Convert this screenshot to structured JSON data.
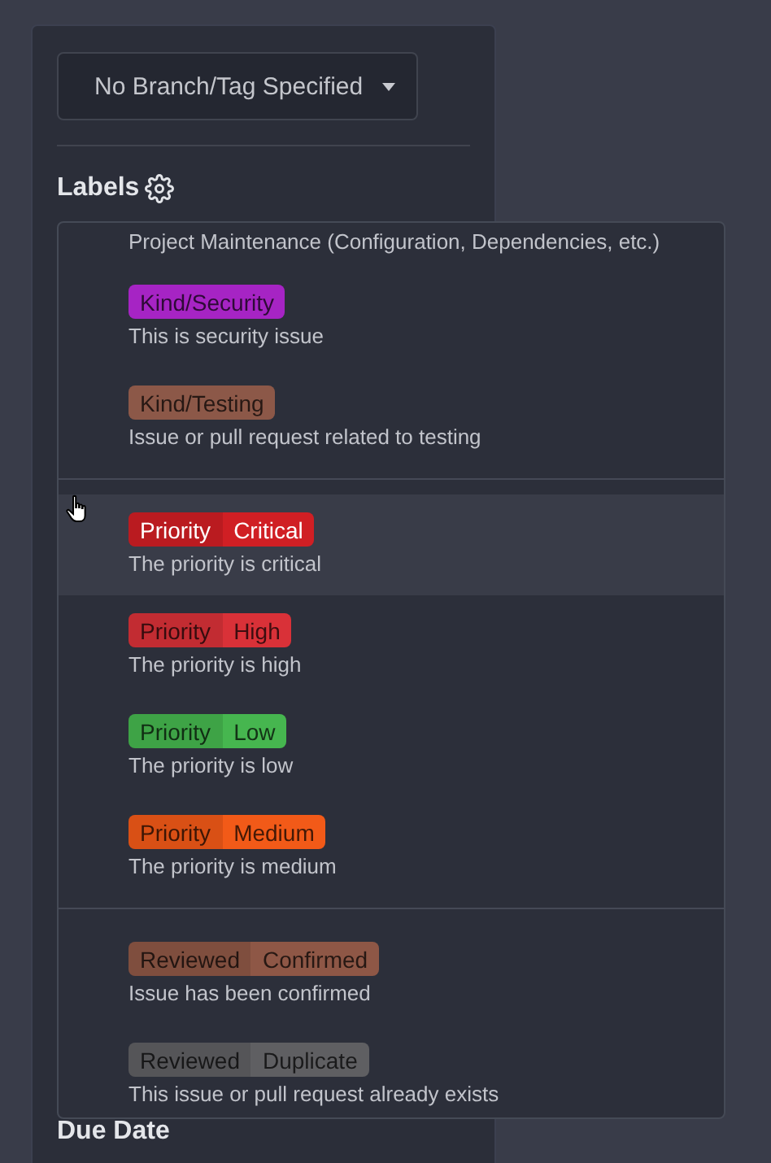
{
  "branch_dropdown": {
    "label": "No Branch/Tag Specified"
  },
  "labels_heading": "Labels",
  "label_menu": {
    "groups": [
      {
        "items": [
          {
            "kind": "description_only",
            "description": "Project Maintenance (Configuration, Dependencies, etc.)",
            "selected": false
          },
          {
            "kind": "plain",
            "name": "Kind/Security",
            "color": "#a624c4",
            "light_text": false,
            "description": "This is security issue",
            "selected": false
          },
          {
            "kind": "plain",
            "name": "Kind/Testing",
            "color": "#8c5848",
            "light_text": false,
            "description": "Issue or pull request related to testing",
            "selected": false
          }
        ]
      },
      {
        "items": [
          {
            "kind": "scoped",
            "scope": "Priority",
            "value": "Critical",
            "color": "#d01f24",
            "light_text": true,
            "description": "The priority is critical",
            "selected": true
          },
          {
            "kind": "scoped",
            "scope": "Priority",
            "value": "High",
            "color": "#d93138",
            "light_text": false,
            "description": "The priority is high",
            "selected": false
          },
          {
            "kind": "scoped",
            "scope": "Priority",
            "value": "Low",
            "color": "#46b64f",
            "light_text": false,
            "description": "The priority is low",
            "selected": false
          },
          {
            "kind": "scoped",
            "scope": "Priority",
            "value": "Medium",
            "color": "#f25a18",
            "light_text": false,
            "description": "The priority is medium",
            "selected": false
          }
        ]
      },
      {
        "items": [
          {
            "kind": "scoped",
            "scope": "Reviewed",
            "value": "Confirmed",
            "color": "#8e5746",
            "light_text": false,
            "description": "Issue has been confirmed",
            "selected": false
          },
          {
            "kind": "scoped",
            "scope": "Reviewed",
            "value": "Duplicate",
            "color": "#5f5f62",
            "light_text": false,
            "description": "This issue or pull request already exists",
            "selected": false
          }
        ]
      }
    ]
  },
  "due_date_heading": "Due Date"
}
